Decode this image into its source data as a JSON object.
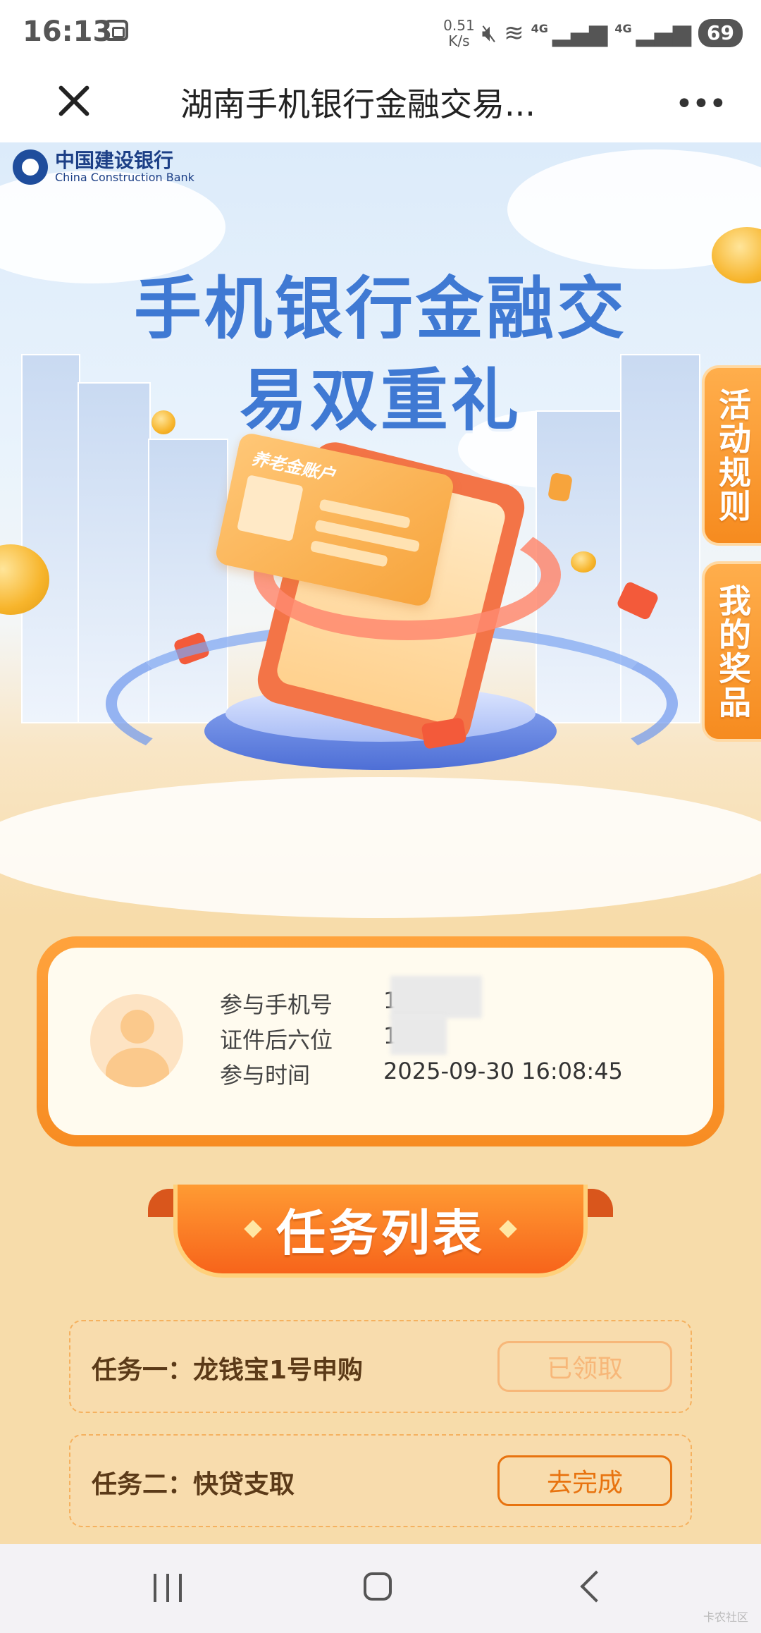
{
  "status_bar": {
    "time": "16:13",
    "net_speed_value": "0.51",
    "net_speed_unit": "K/s",
    "network_1": "4G",
    "network_2": "4G",
    "battery": "69"
  },
  "title_bar": {
    "title": "湖南手机银行金融交易...",
    "more": "•••"
  },
  "hero": {
    "bank_name_cn": "中国建设银行",
    "bank_name_en": "China Construction Bank",
    "title_line1": "手机银行金融交",
    "title_line2": "易双重礼",
    "card_label": "养老金账户"
  },
  "side_tabs": {
    "rules": "活动规则",
    "my_prizes": "我的奖品"
  },
  "user_info": {
    "phone_label": "参与手机号",
    "phone_value": "1",
    "id_label": "证件后六位",
    "id_value": "1",
    "time_label": "参与时间",
    "time_value": "2025-09-30 16:08:45"
  },
  "task_list": {
    "title": "任务列表",
    "tasks": [
      {
        "label": "任务一：龙钱宝1号申购",
        "button": "已领取",
        "status": "done"
      },
      {
        "label": "任务二：快贷支取",
        "button": "去完成",
        "status": "todo"
      }
    ]
  },
  "colors": {
    "accent": "#f78c22",
    "title_blue": "#3f79d3",
    "page_bg": "#f7dcaa"
  },
  "watermark": "卡农社区"
}
